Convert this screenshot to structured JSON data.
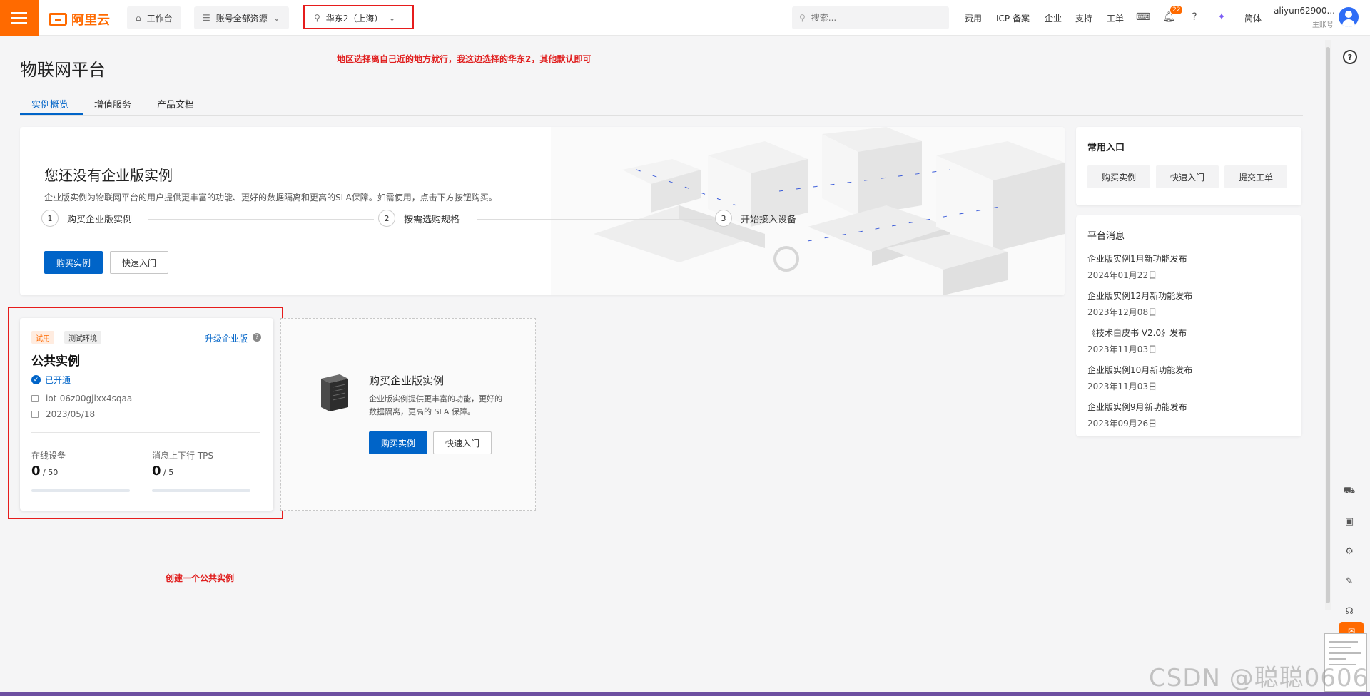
{
  "header": {
    "brand": "阿里云",
    "workbench": "工作台",
    "resources": "账号全部资源",
    "region": "华东2（上海）",
    "search_placeholder": "搜索...",
    "links": [
      "费用",
      "ICP 备案",
      "企业",
      "支持",
      "工单"
    ],
    "notifications": "22",
    "language": "简体",
    "user_name": "aliyun62900...",
    "user_role": "主账号"
  },
  "page": {
    "title": "物联网平台",
    "annotation_region": "地区选择离自己近的地方就行，我这边选择的华东2，其他默认即可",
    "annotation_create": "创建一个公共实例",
    "tabs": [
      "实例概览",
      "增值服务",
      "产品文档"
    ]
  },
  "hero": {
    "title": "您还没有企业版实例",
    "desc": "企业版实例为物联网平台的用户提供更丰富的功能、更好的数据隔离和更高的SLA保障。如需使用，点击下方按钮购买。",
    "steps": [
      {
        "num": "1",
        "label": "购买企业版实例"
      },
      {
        "num": "2",
        "label": "按需选购规格"
      },
      {
        "num": "3",
        "label": "开始接入设备"
      }
    ],
    "buy_label": "购买实例",
    "guide_label": "快速入门"
  },
  "entries": {
    "title": "常用入口",
    "buttons": [
      "购买实例",
      "快速入门",
      "提交工单"
    ]
  },
  "news": {
    "title": "平台消息",
    "items": [
      {
        "title": "企业版实例1月新功能发布",
        "date": "2024年01月22日"
      },
      {
        "title": "企业版实例12月新功能发布",
        "date": "2023年12月08日"
      },
      {
        "title": "《技术白皮书 V2.0》发布",
        "date": "2023年11月03日"
      },
      {
        "title": "企业版实例10月新功能发布",
        "date": "2023年11月03日"
      },
      {
        "title": "企业版实例9月新功能发布",
        "date": "2023年09月26日"
      }
    ]
  },
  "instance": {
    "tag_trial": "试用",
    "tag_env": "测试环境",
    "upgrade": "升级企业版",
    "name": "公共实例",
    "status": "已开通",
    "id": "iot-06z00gjlxx4sqaa",
    "date": "2023/05/18",
    "devices_label": "在线设备",
    "devices_value": "0",
    "devices_limit": " / 50",
    "devices_progress": 0,
    "tps_label": "消息上下行 TPS",
    "tps_value": "0",
    "tps_limit": " / 5",
    "tps_progress": 0
  },
  "buy_card": {
    "title": "购买企业版实例",
    "desc": "企业版实例提供更丰富的功能，更好的数据隔离，更高的 SLA 保障。",
    "buy_label": "购买实例",
    "guide_label": "快速入门"
  },
  "watermark": "CSDN @聪聪0606",
  "colors": {
    "brand": "#ff6a00",
    "primary": "#0064c8",
    "annotation": "#e61c1c"
  }
}
